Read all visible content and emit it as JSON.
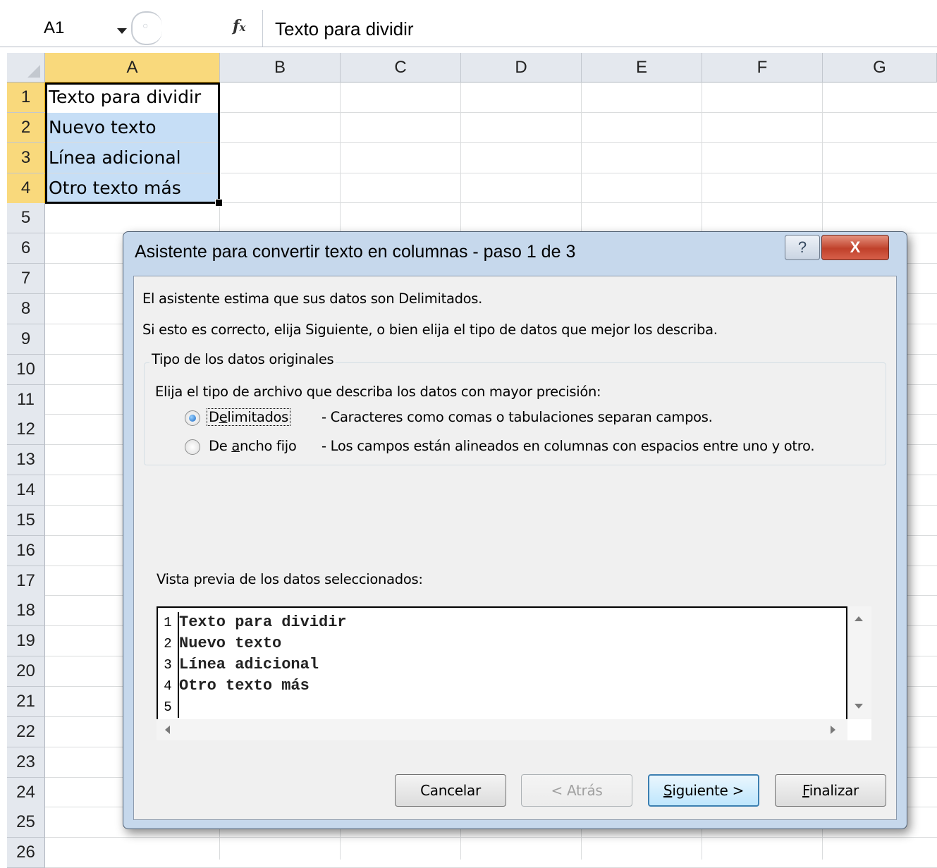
{
  "formula_bar": {
    "name_box": "A1",
    "fx_icon": "fx-icon",
    "content": "Texto para dividir"
  },
  "sheet": {
    "columns": [
      "A",
      "B",
      "C",
      "D",
      "E",
      "F",
      "G"
    ],
    "selected_column": "A",
    "rows": [
      "1",
      "2",
      "3",
      "4",
      "5",
      "6",
      "7",
      "8",
      "9",
      "10",
      "11",
      "12",
      "13",
      "14",
      "15",
      "16",
      "17",
      "18",
      "19",
      "20",
      "21",
      "22",
      "23",
      "24",
      "25",
      "26"
    ],
    "selected_rows": [
      "1",
      "2",
      "3",
      "4"
    ],
    "cells": {
      "A1": "Texto para dividir",
      "A2": "Nuevo texto",
      "A3": "Línea adicional",
      "A4": "Otro texto más"
    }
  },
  "dialog": {
    "title": "Asistente para convertir texto en columnas - paso 1 de 3",
    "help_label": "?",
    "close_label": "X",
    "intro_line1": "El asistente estima que sus datos son Delimitados.",
    "intro_line2": "Si esto es correcto, elija Siguiente, o bien elija el tipo de datos que mejor los describa.",
    "group_label": "Tipo de los datos originales",
    "group_prompt": "Elija el tipo de archivo que describa los datos con mayor precisión:",
    "options": [
      {
        "label_pre": "D",
        "label_ul": "e",
        "label_post": "limitados",
        "description": "- Caracteres como comas o tabulaciones separan campos.",
        "selected": true
      },
      {
        "label_pre": "De ",
        "label_ul": "a",
        "label_post": "ncho fijo",
        "description": "- Los campos están alineados en columnas con espacios entre uno y otro.",
        "selected": false
      }
    ],
    "preview_label": "Vista previa de los datos seleccionados:",
    "preview_rows": [
      {
        "num": "1",
        "text": "Texto para dividir"
      },
      {
        "num": "2",
        "text": "Nuevo texto"
      },
      {
        "num": "3",
        "text": "Línea adicional"
      },
      {
        "num": "4",
        "text": "Otro texto más"
      },
      {
        "num": "5",
        "text": ""
      }
    ],
    "buttons": {
      "cancel": "Cancelar",
      "back": "< Atrás",
      "next_ul": "S",
      "next_rest": "iguiente >",
      "finish_ul": "F",
      "finish_rest": "inalizar"
    }
  },
  "colors": {
    "selection_header": "#f9d97c",
    "selection_fill": "#c6def6",
    "dialog_frame": "#c6d8ec",
    "close_button": "#c0412b"
  }
}
